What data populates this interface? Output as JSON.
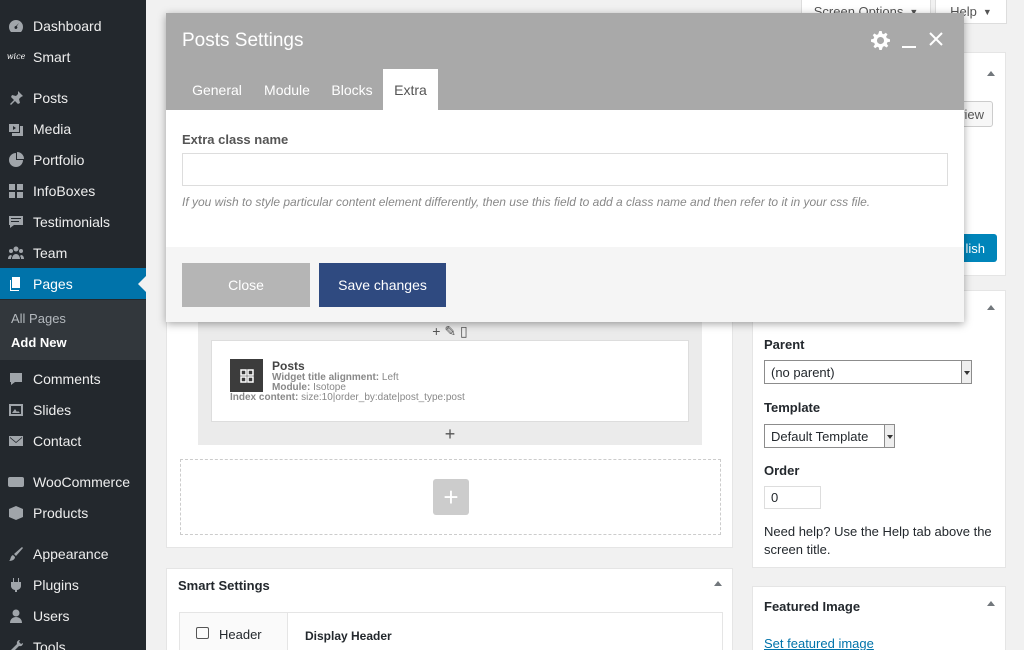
{
  "sidebar": {
    "items": [
      {
        "label": "Dashboard",
        "icon": "dashboard-icon"
      },
      {
        "label": "Smart",
        "icon": "smart-logo-icon"
      },
      {
        "label": "Posts",
        "icon": "pin-icon"
      },
      {
        "label": "Media",
        "icon": "media-icon"
      },
      {
        "label": "Portfolio",
        "icon": "portfolio-icon"
      },
      {
        "label": "InfoBoxes",
        "icon": "grid-icon"
      },
      {
        "label": "Testimonials",
        "icon": "testimonial-icon"
      },
      {
        "label": "Team",
        "icon": "team-icon"
      },
      {
        "label": "Pages",
        "icon": "pages-icon"
      },
      {
        "label": "Comments",
        "icon": "comments-icon"
      },
      {
        "label": "Slides",
        "icon": "slides-icon"
      },
      {
        "label": "Contact",
        "icon": "mail-icon"
      },
      {
        "label": "WooCommerce",
        "icon": "woo-icon"
      },
      {
        "label": "Products",
        "icon": "products-icon"
      },
      {
        "label": "Appearance",
        "icon": "brush-icon"
      },
      {
        "label": "Plugins",
        "icon": "plugin-icon"
      },
      {
        "label": "Users",
        "icon": "users-icon"
      },
      {
        "label": "Tools",
        "icon": "tools-icon"
      }
    ],
    "smart_logo": "wice",
    "submenu": [
      "All Pages",
      "Add New"
    ],
    "accent": "#0073aa"
  },
  "top": {
    "screen_options": "Screen Options",
    "help": "Help"
  },
  "modal": {
    "title": "Posts Settings",
    "tabs": [
      "General",
      "Module",
      "Blocks",
      "Extra"
    ],
    "active_tab": "Extra",
    "field_label": "Extra class name",
    "field_value": "",
    "help_text": "If you wish to style particular content element differently, then use this field to add a class name and then refer to it in your css file.",
    "close_label": "Close",
    "save_label": "Save changes",
    "save_color": "#2f4a80"
  },
  "element": {
    "name": "Posts",
    "line1_key": "Widget title alignment:",
    "line1_val": "Left",
    "line2_key": "Module:",
    "line2_val": "Isotope",
    "line3_key": "Index content:",
    "line3_val": "size:10|order_by:date|post_type:post"
  },
  "publish": {
    "preview_partial": "view",
    "publish_partial": "lish"
  },
  "attributes": {
    "parent_label": "Parent",
    "parent_value": "(no parent)",
    "template_label": "Template",
    "template_value": "Default Template",
    "order_label": "Order",
    "order_value": "0",
    "help": "Need help? Use the Help tab above the screen title."
  },
  "smart_settings": {
    "title": "Smart Settings",
    "tab_label": "Header",
    "section_title": "Display Header"
  },
  "featured_image": {
    "title": "Featured Image",
    "link": "Set featured image"
  }
}
